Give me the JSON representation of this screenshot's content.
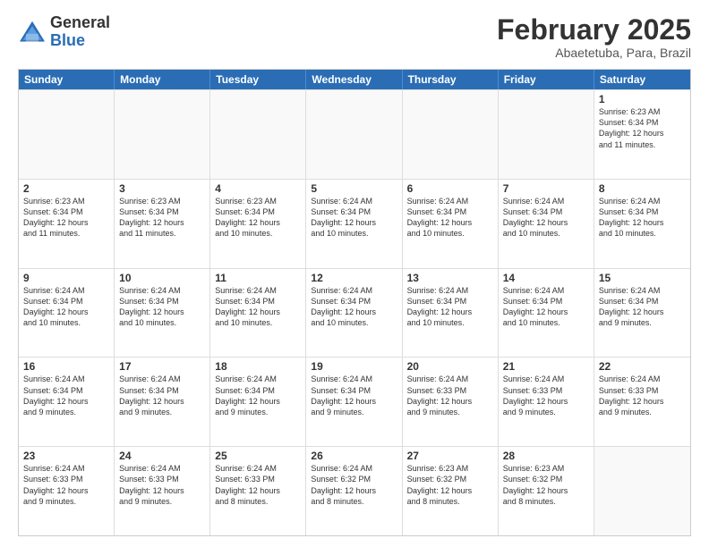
{
  "header": {
    "logo_general": "General",
    "logo_blue": "Blue",
    "month_title": "February 2025",
    "subtitle": "Abaetetuba, Para, Brazil"
  },
  "days_of_week": [
    "Sunday",
    "Monday",
    "Tuesday",
    "Wednesday",
    "Thursday",
    "Friday",
    "Saturday"
  ],
  "weeks": [
    [
      {
        "day": "",
        "empty": true
      },
      {
        "day": "",
        "empty": true
      },
      {
        "day": "",
        "empty": true
      },
      {
        "day": "",
        "empty": true
      },
      {
        "day": "",
        "empty": true
      },
      {
        "day": "",
        "empty": true
      },
      {
        "day": "1",
        "text": "Sunrise: 6:23 AM\nSunset: 6:34 PM\nDaylight: 12 hours\nand 11 minutes."
      }
    ],
    [
      {
        "day": "2",
        "text": "Sunrise: 6:23 AM\nSunset: 6:34 PM\nDaylight: 12 hours\nand 11 minutes."
      },
      {
        "day": "3",
        "text": "Sunrise: 6:23 AM\nSunset: 6:34 PM\nDaylight: 12 hours\nand 11 minutes."
      },
      {
        "day": "4",
        "text": "Sunrise: 6:23 AM\nSunset: 6:34 PM\nDaylight: 12 hours\nand 10 minutes."
      },
      {
        "day": "5",
        "text": "Sunrise: 6:24 AM\nSunset: 6:34 PM\nDaylight: 12 hours\nand 10 minutes."
      },
      {
        "day": "6",
        "text": "Sunrise: 6:24 AM\nSunset: 6:34 PM\nDaylight: 12 hours\nand 10 minutes."
      },
      {
        "day": "7",
        "text": "Sunrise: 6:24 AM\nSunset: 6:34 PM\nDaylight: 12 hours\nand 10 minutes."
      },
      {
        "day": "8",
        "text": "Sunrise: 6:24 AM\nSunset: 6:34 PM\nDaylight: 12 hours\nand 10 minutes."
      }
    ],
    [
      {
        "day": "9",
        "text": "Sunrise: 6:24 AM\nSunset: 6:34 PM\nDaylight: 12 hours\nand 10 minutes."
      },
      {
        "day": "10",
        "text": "Sunrise: 6:24 AM\nSunset: 6:34 PM\nDaylight: 12 hours\nand 10 minutes."
      },
      {
        "day": "11",
        "text": "Sunrise: 6:24 AM\nSunset: 6:34 PM\nDaylight: 12 hours\nand 10 minutes."
      },
      {
        "day": "12",
        "text": "Sunrise: 6:24 AM\nSunset: 6:34 PM\nDaylight: 12 hours\nand 10 minutes."
      },
      {
        "day": "13",
        "text": "Sunrise: 6:24 AM\nSunset: 6:34 PM\nDaylight: 12 hours\nand 10 minutes."
      },
      {
        "day": "14",
        "text": "Sunrise: 6:24 AM\nSunset: 6:34 PM\nDaylight: 12 hours\nand 10 minutes."
      },
      {
        "day": "15",
        "text": "Sunrise: 6:24 AM\nSunset: 6:34 PM\nDaylight: 12 hours\nand 9 minutes."
      }
    ],
    [
      {
        "day": "16",
        "text": "Sunrise: 6:24 AM\nSunset: 6:34 PM\nDaylight: 12 hours\nand 9 minutes."
      },
      {
        "day": "17",
        "text": "Sunrise: 6:24 AM\nSunset: 6:34 PM\nDaylight: 12 hours\nand 9 minutes."
      },
      {
        "day": "18",
        "text": "Sunrise: 6:24 AM\nSunset: 6:34 PM\nDaylight: 12 hours\nand 9 minutes."
      },
      {
        "day": "19",
        "text": "Sunrise: 6:24 AM\nSunset: 6:34 PM\nDaylight: 12 hours\nand 9 minutes."
      },
      {
        "day": "20",
        "text": "Sunrise: 6:24 AM\nSunset: 6:33 PM\nDaylight: 12 hours\nand 9 minutes."
      },
      {
        "day": "21",
        "text": "Sunrise: 6:24 AM\nSunset: 6:33 PM\nDaylight: 12 hours\nand 9 minutes."
      },
      {
        "day": "22",
        "text": "Sunrise: 6:24 AM\nSunset: 6:33 PM\nDaylight: 12 hours\nand 9 minutes."
      }
    ],
    [
      {
        "day": "23",
        "text": "Sunrise: 6:24 AM\nSunset: 6:33 PM\nDaylight: 12 hours\nand 9 minutes."
      },
      {
        "day": "24",
        "text": "Sunrise: 6:24 AM\nSunset: 6:33 PM\nDaylight: 12 hours\nand 9 minutes."
      },
      {
        "day": "25",
        "text": "Sunrise: 6:24 AM\nSunset: 6:33 PM\nDaylight: 12 hours\nand 8 minutes."
      },
      {
        "day": "26",
        "text": "Sunrise: 6:24 AM\nSunset: 6:32 PM\nDaylight: 12 hours\nand 8 minutes."
      },
      {
        "day": "27",
        "text": "Sunrise: 6:23 AM\nSunset: 6:32 PM\nDaylight: 12 hours\nand 8 minutes."
      },
      {
        "day": "28",
        "text": "Sunrise: 6:23 AM\nSunset: 6:32 PM\nDaylight: 12 hours\nand 8 minutes."
      },
      {
        "day": "",
        "empty": true
      }
    ]
  ]
}
